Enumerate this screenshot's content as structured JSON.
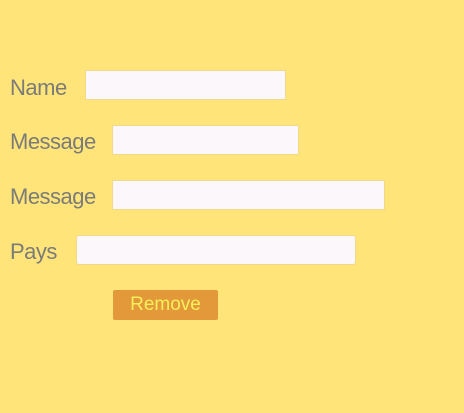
{
  "form": {
    "fields": [
      {
        "label": "Name",
        "value": ""
      },
      {
        "label": "Message",
        "value": ""
      },
      {
        "label": "Message",
        "value": ""
      },
      {
        "label": "Pays",
        "value": ""
      }
    ],
    "remove_label": "Remove"
  },
  "colors": {
    "background": "#ffe47a",
    "button": "#e3983a",
    "button_text": "#f5f05a"
  }
}
